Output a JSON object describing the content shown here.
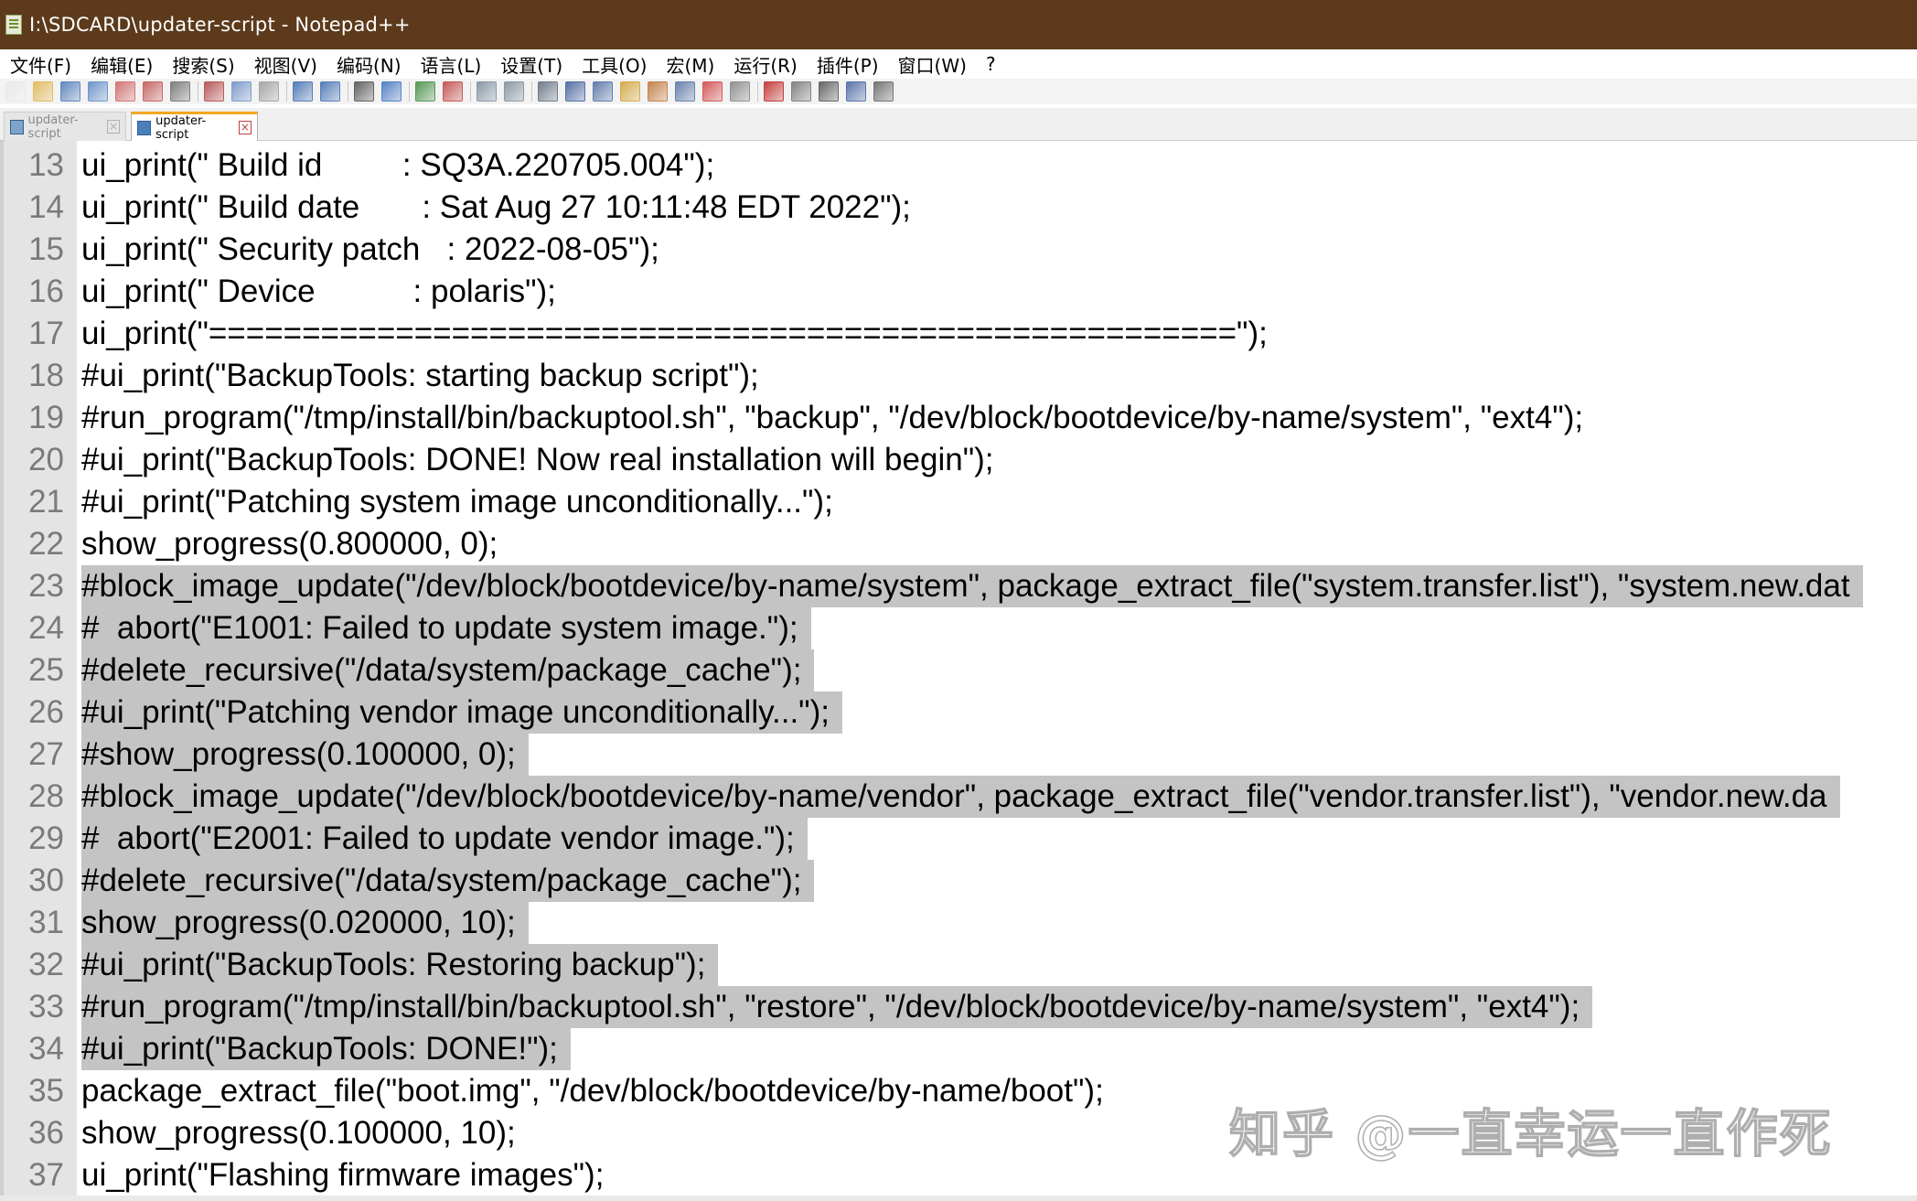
{
  "window": {
    "title": "I:\\SDCARD\\updater-script - Notepad++"
  },
  "menu": {
    "items": [
      "文件(F)",
      "编辑(E)",
      "搜索(S)",
      "视图(V)",
      "编码(N)",
      "语言(L)",
      "设置(T)",
      "工具(O)",
      "宏(M)",
      "运行(R)",
      "插件(P)",
      "窗口(W)",
      "?"
    ]
  },
  "toolbar": {
    "buttons": [
      "new-file-icon",
      "open-file-icon",
      "save-icon",
      "save-all-icon",
      "close-icon",
      "close-all-icon",
      "print-icon",
      "cut-icon",
      "copy-icon",
      "paste-icon",
      "undo-icon",
      "redo-icon",
      "find-icon",
      "replace-icon",
      "zoom-in-icon",
      "zoom-out-icon",
      "sync-vertical-icon",
      "sync-horizontal-icon",
      "word-wrap-icon",
      "show-all-chars-icon",
      "indent-guide-icon",
      "user-lang-icon",
      "doc-map-icon",
      "function-list-icon",
      "folder-workspace-icon",
      "monitoring-icon",
      "record-macro-icon",
      "stop-macro-icon",
      "play-macro-icon",
      "run-macro-multiple-icon",
      "save-macro-icon"
    ]
  },
  "tabs": [
    {
      "label": "updater-script",
      "active": false
    },
    {
      "label": "updater-script",
      "active": true
    }
  ],
  "editor": {
    "lines": [
      {
        "num": "13",
        "text": "ui_print(\" Build id         : SQ3A.220705.004\");",
        "selected": false
      },
      {
        "num": "14",
        "text": "ui_print(\" Build date       : Sat Aug 27 10:11:48 EDT 2022\");",
        "selected": false
      },
      {
        "num": "15",
        "text": "ui_print(\" Security patch   : 2022-08-05\");",
        "selected": false
      },
      {
        "num": "16",
        "text": "ui_print(\" Device           : polaris\");",
        "selected": false
      },
      {
        "num": "17",
        "text": "ui_print(\"=======================================================\");",
        "selected": false
      },
      {
        "num": "18",
        "text": "#ui_print(\"BackupTools: starting backup script\");",
        "selected": false
      },
      {
        "num": "19",
        "text": "#run_program(\"/tmp/install/bin/backuptool.sh\", \"backup\", \"/dev/block/bootdevice/by-name/system\", \"ext4\");",
        "selected": false
      },
      {
        "num": "20",
        "text": "#ui_print(\"BackupTools: DONE! Now real installation will begin\");",
        "selected": false
      },
      {
        "num": "21",
        "text": "#ui_print(\"Patching system image unconditionally...\");",
        "selected": false
      },
      {
        "num": "22",
        "text": "show_progress(0.800000, 0);",
        "selected": false
      },
      {
        "num": "23",
        "text": "#block_image_update(\"/dev/block/bootdevice/by-name/system\", package_extract_file(\"system.transfer.list\"), \"system.new.dat",
        "selected": true
      },
      {
        "num": "24",
        "text": "#  abort(\"E1001: Failed to update system image.\");",
        "selected": true
      },
      {
        "num": "25",
        "text": "#delete_recursive(\"/data/system/package_cache\");",
        "selected": true
      },
      {
        "num": "26",
        "text": "#ui_print(\"Patching vendor image unconditionally...\");",
        "selected": true
      },
      {
        "num": "27",
        "text": "#show_progress(0.100000, 0);",
        "selected": true
      },
      {
        "num": "28",
        "text": "#block_image_update(\"/dev/block/bootdevice/by-name/vendor\", package_extract_file(\"vendor.transfer.list\"), \"vendor.new.da",
        "selected": true
      },
      {
        "num": "29",
        "text": "#  abort(\"E2001: Failed to update vendor image.\");",
        "selected": true
      },
      {
        "num": "30",
        "text": "#delete_recursive(\"/data/system/package_cache\");",
        "selected": true
      },
      {
        "num": "31",
        "text": "show_progress(0.020000, 10);",
        "selected": true
      },
      {
        "num": "32",
        "text": "#ui_print(\"BackupTools: Restoring backup\");",
        "selected": true
      },
      {
        "num": "33",
        "text": "#run_program(\"/tmp/install/bin/backuptool.sh\", \"restore\", \"/dev/block/bootdevice/by-name/system\", \"ext4\");",
        "selected": true
      },
      {
        "num": "34",
        "text": "#ui_print(\"BackupTools: DONE!\");",
        "selected": true
      },
      {
        "num": "35",
        "text": "package_extract_file(\"boot.img\", \"/dev/block/bootdevice/by-name/boot\");",
        "selected": false
      },
      {
        "num": "36",
        "text": "show_progress(0.100000, 10);",
        "selected": false
      },
      {
        "num": "37",
        "text": "ui_print(\"Flashing firmware images\");",
        "selected": false
      }
    ]
  },
  "watermark": {
    "text": "知乎 @一直幸运一直作死"
  },
  "colors": {
    "titlebar": "#5c3a1b",
    "selection": "#c4c4c4",
    "gutter": "#e4e4e4",
    "line_number": "#7a7a7a"
  }
}
